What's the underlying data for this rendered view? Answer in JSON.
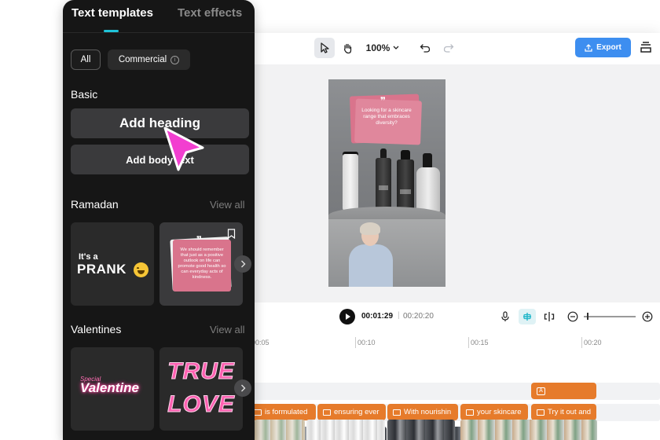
{
  "panel": {
    "tabs": [
      {
        "label": "Text templates",
        "active": true
      },
      {
        "label": "Text effects",
        "active": false
      }
    ],
    "filters": [
      {
        "label": "All",
        "selected": true
      },
      {
        "label": "Commercial",
        "selected": false
      }
    ],
    "sections": {
      "basic": {
        "title": "Basic",
        "add_heading": "Add heading",
        "add_body": "Add body text"
      },
      "ramadan": {
        "title": "Ramadan",
        "view_all": "View all",
        "cards": [
          {
            "small": "It's a",
            "big": "PRANK"
          },
          {
            "quote": "We should remember that just as a positive outlook on life can promote good health so can everyday acts of kindness."
          }
        ]
      },
      "valentines": {
        "title": "Valentines",
        "view_all": "View all",
        "cards": [
          {
            "small": "Special",
            "big": "Valentine"
          },
          {
            "line1": "TRUE",
            "line2": "LOVE"
          }
        ]
      }
    }
  },
  "toolbar": {
    "zoom": "100%",
    "export_label": "Export"
  },
  "canvas": {
    "quote_text": "Looking for a skincare range that embraces diversity?"
  },
  "playback": {
    "current_time": "00:01:29",
    "separator": "|",
    "total_time": "00:20:20"
  },
  "timeline": {
    "ruler": [
      {
        "label": "00:05"
      },
      {
        "label": "00:10"
      },
      {
        "label": "00:15"
      },
      {
        "label": "00:20"
      }
    ],
    "text_clips": [
      {
        "label": "is formulated"
      },
      {
        "label": "ensuring ever"
      },
      {
        "label": "With nourishin"
      },
      {
        "label": "your skincare"
      },
      {
        "label": "Try it out and"
      }
    ]
  },
  "colors": {
    "accent": "#1fc3d8",
    "export": "#3d8ef0",
    "clip": "#e67b2b",
    "cursor": "#f23fd0",
    "card_pink": "#d9748c"
  }
}
